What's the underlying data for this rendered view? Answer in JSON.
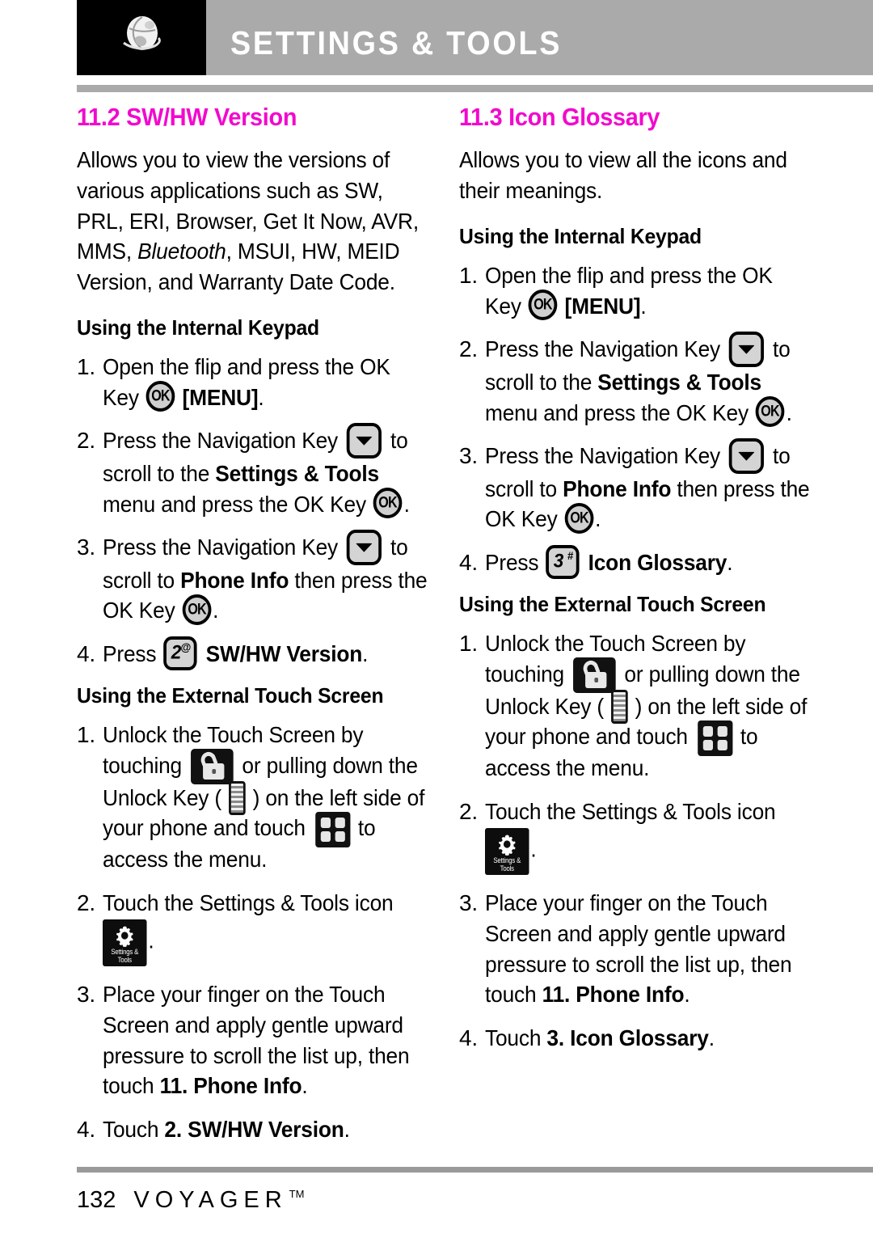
{
  "header": {
    "title": "SETTINGS & TOOLS",
    "icon": "globe-icon"
  },
  "left_column": {
    "section_number_title": "11.2 SW/HW Version",
    "intro": "Allows you to view the versions of various applications such as SW, PRL, ERI, Browser, Get It Now, AVR, MMS, ",
    "intro_italic": "Bluetooth",
    "intro_tail": ", MSUI, HW, MEID Version, and Warranty Date Code.",
    "internal_keypad_heading": "Using the Internal Keypad",
    "keypad_steps": [
      {
        "num": "1.",
        "a": "Open the flip and press the OK Key ",
        "icon": "ok-key-icon",
        "b": " ",
        "bold": "[MENU]",
        "c": "."
      },
      {
        "num": "2.",
        "a": "Press the Navigation Key ",
        "icon": "navigation-down-key-icon",
        "b": " to scroll to the ",
        "bold": "Settings & Tools",
        "c": " menu and press the OK Key ",
        "icon2": "ok-key-icon",
        "d": "."
      },
      {
        "num": "3.",
        "a": "Press the Navigation Key ",
        "icon": "navigation-down-key-icon",
        "b": " to scroll to ",
        "bold": "Phone Info",
        "c": " then press the OK Key ",
        "icon2": "ok-key-icon",
        "d": "."
      },
      {
        "num": "4.",
        "a": "Press ",
        "icon": "keypad-2-key-icon",
        "key_digit": "2",
        "key_sup": "@",
        "b": " ",
        "bold": "SW/HW Version",
        "c": "."
      }
    ],
    "touch_screen_heading": "Using the External Touch Screen",
    "touch_steps": [
      {
        "num": "1.",
        "a": "Unlock the Touch Screen by touching ",
        "icon": "padlock-unlock-icon",
        "b": " or pulling down the Unlock Key ( ",
        "icon2": "unlock-key-icon",
        "c": " ) on the left side of your phone and touch ",
        "icon3": "menu-grid-icon",
        "d": " to access the menu."
      },
      {
        "num": "2.",
        "a": "Touch the Settings & Tools icon ",
        "icon": "settings-and-tools-app-icon",
        "icon_caption_line1": "Settings &",
        "icon_caption_line2": "Tools",
        "b": "."
      },
      {
        "num": "3.",
        "a": "Place your finger on the Touch Screen and apply gentle upward pressure to scroll the list up, then touch ",
        "bold": "11. Phone Info",
        "c": "."
      },
      {
        "num": "4.",
        "a": "Touch ",
        "bold": "2. SW/HW Version",
        "c": "."
      }
    ]
  },
  "right_column": {
    "section_number_title": "11.3 Icon Glossary",
    "intro": "Allows you to view all the icons and their meanings.",
    "internal_keypad_heading": "Using the Internal Keypad",
    "keypad_steps": [
      {
        "num": "1.",
        "a": "Open the flip and press the OK Key ",
        "icon": "ok-key-icon",
        "b": " ",
        "bold": "[MENU]",
        "c": "."
      },
      {
        "num": "2.",
        "a": "Press the Navigation Key ",
        "icon": "navigation-down-key-icon",
        "b": " to scroll to the ",
        "bold": "Settings & Tools",
        "c": " menu and press the OK Key ",
        "icon2": "ok-key-icon",
        "d": "."
      },
      {
        "num": "3.",
        "a": "Press the Navigation Key ",
        "icon": "navigation-down-key-icon",
        "b": " to scroll to ",
        "bold": "Phone Info",
        "c": " then press the OK Key ",
        "icon2": "ok-key-icon",
        "d": "."
      },
      {
        "num": "4.",
        "a": "Press ",
        "icon": "keypad-3-key-icon",
        "key_digit": "3",
        "key_sup": "#",
        "b": " ",
        "bold": "Icon Glossary",
        "c": "."
      }
    ],
    "touch_screen_heading": "Using the External Touch Screen",
    "touch_steps": [
      {
        "num": "1.",
        "a": "Unlock the Touch Screen by touching ",
        "icon": "padlock-unlock-icon",
        "b": " or pulling down the Unlock Key ( ",
        "icon2": "unlock-key-icon",
        "c": " ) on the left side of your phone and touch ",
        "icon3": "menu-grid-icon",
        "d": " to access the menu."
      },
      {
        "num": "2.",
        "a": "Touch the Settings & Tools icon ",
        "icon": "settings-and-tools-app-icon",
        "icon_caption_line1": "Settings &",
        "icon_caption_line2": "Tools",
        "b": "."
      },
      {
        "num": "3.",
        "a": "Place your finger on the Touch Screen and apply gentle upward pressure to scroll the list up, then touch ",
        "bold": "11. Phone Info",
        "c": "."
      },
      {
        "num": "4.",
        "a": "Touch ",
        "bold": "3. Icon Glossary",
        "c": "."
      }
    ]
  },
  "footer": {
    "page_number": "132",
    "brand": "VOYAGER",
    "trademark": "TM"
  },
  "colors": {
    "heading_magenta": "#f209cd",
    "header_band_gray": "#aaaaaa",
    "rule_gray": "#9a9a9a",
    "icon_black": "#000000"
  }
}
